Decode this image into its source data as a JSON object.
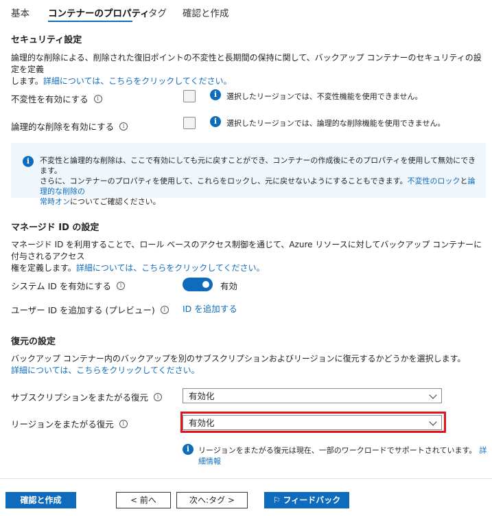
{
  "tabs": [
    {
      "label": "基本"
    },
    {
      "label": "コンテナーのプロパティ"
    },
    {
      "label": "タグ"
    },
    {
      "label": "確認と作成"
    }
  ],
  "security": {
    "title": "セキュリティ設定",
    "desc_line1": "論理的な削除による、削除された復旧ポイントの不変性と長期間の保持に関して、バックアップ コンテナーのセキュリティの設定を定義",
    "desc_line2": "します。",
    "desc_link": "詳細については、こちらをクリックしてください。",
    "immutability_label": "不変性を有効にする",
    "immutability_note": "選択したリージョンでは、不変性機能を使用できません。",
    "softdelete_label": "論理的な削除を有効にする",
    "softdelete_note": "選択したリージョンでは、論理的な削除機能を使用できません。",
    "banner_line1": "不変性と論理的な削除は、ここで有効にしても元に戻すことができ、コンテナーの作成後にそのプロパティを使用して無効にできます。",
    "banner_line2_prefix": "さらに、コンテナーのプロパティを使用して、これらをロックし、元に戻せないようにすることもできます。",
    "banner_link1": "不変性のロック",
    "banner_and": "と",
    "banner_link2a": "論理的な削除の",
    "banner_link2b": "常時オン",
    "banner_suffix": "についてご確認ください。"
  },
  "identity": {
    "title": "マネージド ID の設定",
    "desc_line1": "マネージド ID を利用することで、ロール ベースのアクセス制御を通じて、Azure リソースに対してバックアップ コンテナーに付与されるアクセス",
    "desc_line2": "権を定義します。",
    "desc_link": "詳細については、こちらをクリックしてください。",
    "system_label": "システム ID を有効にする",
    "system_value": "有効",
    "user_label": "ユーザー ID を追加する (プレビュー)",
    "user_link": "ID を追加する"
  },
  "restore": {
    "title": "復元の設定",
    "desc": "バックアップ コンテナー内のバックアップを別のサブスクリプションおよびリージョンに復元するかどうかを選択します。",
    "desc_link": "詳細については、こちらをクリックしてください。",
    "cross_sub_label": "サブスクリプションをまたがる復元",
    "cross_sub_value": "有効化",
    "cross_region_label": "リージョンをまたがる復元",
    "cross_region_value": "有効化",
    "region_note": "リージョンをまたがる復元は現在、一部のワークロードでサポートされています。",
    "region_note_link": "詳細情報"
  },
  "footer": {
    "review_create": "確認と作成",
    "prev": "< 前へ",
    "next": "次へ:タグ >",
    "feedback": "フィードバック"
  },
  "colors": {
    "accent": "#0f6cbd",
    "highlight": "#e0161e",
    "banner_bg": "#eff6fc"
  }
}
